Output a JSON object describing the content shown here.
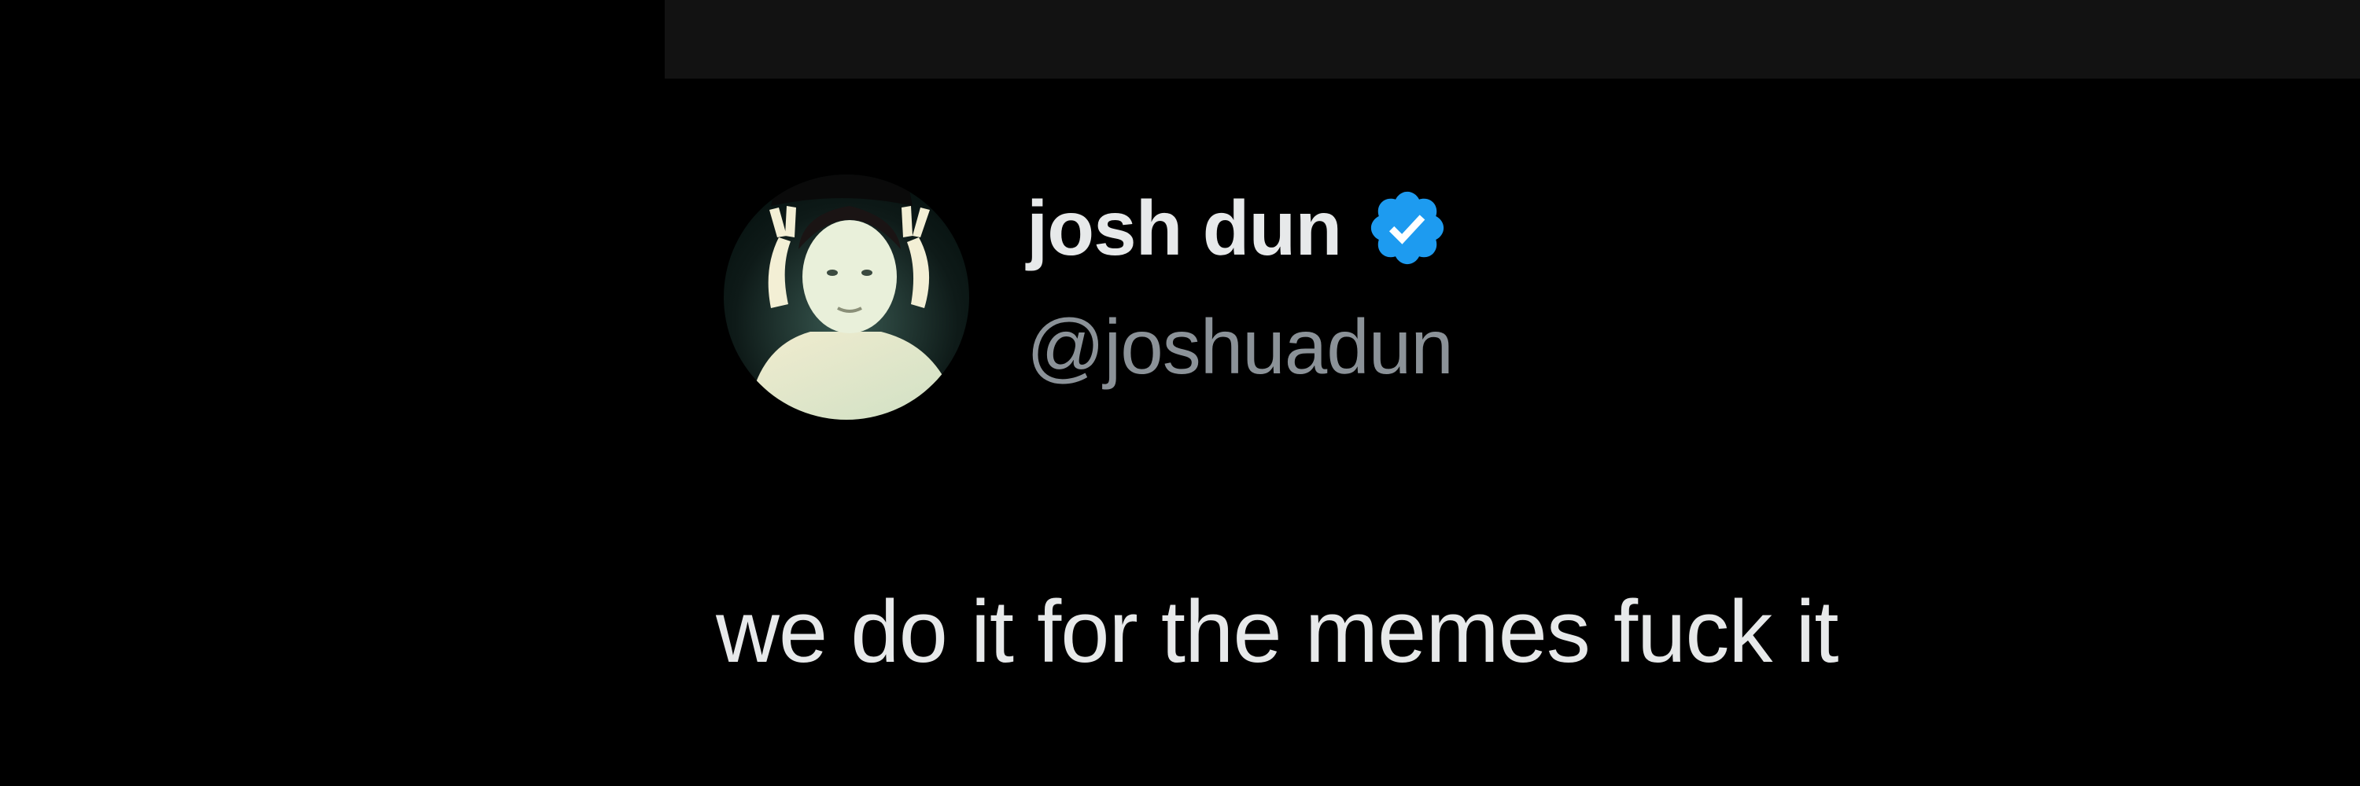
{
  "tweet": {
    "author": {
      "display_name": "josh dun",
      "handle": "@joshuadun",
      "verified": true,
      "verified_badge_color": "#1d9bf0",
      "avatar_icon": "profile-photo"
    },
    "text": "we do it for the memes fuck it"
  },
  "theme": {
    "background": "#000000",
    "top_bar": "#121212",
    "text_primary": "#e7e9ea",
    "text_secondary": "#8b9298"
  }
}
